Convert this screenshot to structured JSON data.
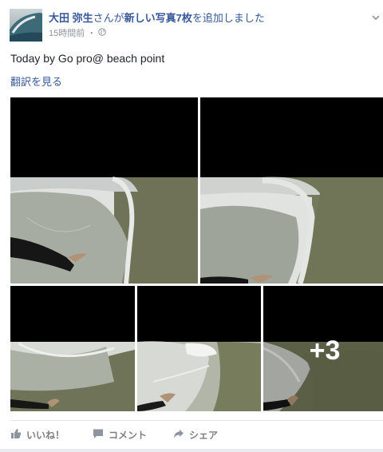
{
  "post": {
    "author": "大田 弥生",
    "action_prefix": "さんが",
    "action_emphasis": "新しい写真7枚",
    "action_suffix": "を追加しました",
    "time": "15時間前",
    "separator": "・",
    "audience_icon": "globe-icon",
    "text": "Today by Go pro@ beach point",
    "translate_label": "翻訳を見る"
  },
  "photos": {
    "count": 5,
    "more_label": "+3"
  },
  "actions": {
    "like_label": "いいね！",
    "comment_label": "コメント",
    "share_label": "シェア"
  },
  "colors": {
    "link": "#365899",
    "meta": "#90949c",
    "action_text": "#7f7f7f"
  }
}
